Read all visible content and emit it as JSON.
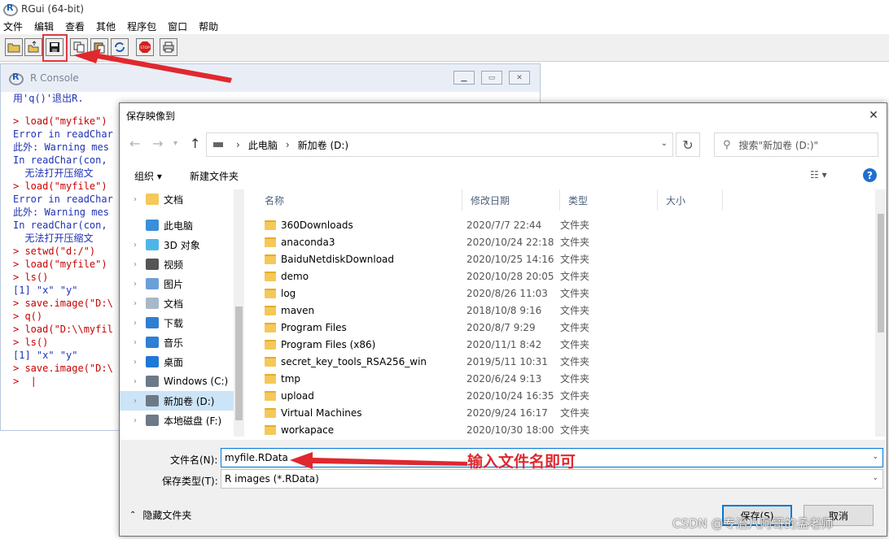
{
  "app": {
    "title": "RGui (64-bit)",
    "menu": [
      "文件",
      "编辑",
      "查看",
      "其他",
      "程序包",
      "窗口",
      "帮助"
    ]
  },
  "toolbar": {
    "buttons": [
      "open-script-icon",
      "load-workspace-icon",
      "save-workspace-icon",
      "copy-icon",
      "paste-icon",
      "copy-paste-icon",
      "stop-icon",
      "print-icon"
    ]
  },
  "console": {
    "title": "R Console",
    "lines": [
      {
        "text": "用'q()'退出R.",
        "color": "blue"
      },
      {
        "text": "",
        "color": "gap"
      },
      {
        "text": "> load(\"myfike\")",
        "color": "red"
      },
      {
        "text": "Error in readChar",
        "color": "blue"
      },
      {
        "text": "此外: Warning mes",
        "color": "blue"
      },
      {
        "text": "In readChar(con,",
        "color": "blue"
      },
      {
        "text": "  无法打开压缩文",
        "color": "blue"
      },
      {
        "text": "> load(\"myfile\")",
        "color": "red"
      },
      {
        "text": "Error in readChar",
        "color": "blue"
      },
      {
        "text": "此外: Warning mes",
        "color": "blue"
      },
      {
        "text": "In readChar(con,",
        "color": "blue"
      },
      {
        "text": "  无法打开压缩文",
        "color": "blue"
      },
      {
        "text": "> setwd(\"d:/\")",
        "color": "red"
      },
      {
        "text": "> load(\"myfile\")",
        "color": "red"
      },
      {
        "text": "> ls()",
        "color": "red"
      },
      {
        "text": "[1] \"x\" \"y\"",
        "color": "blue"
      },
      {
        "text": "> save.image(\"D:\\",
        "color": "red"
      },
      {
        "text": "> q()",
        "color": "red"
      },
      {
        "text": "> load(\"D:\\\\myfil",
        "color": "red"
      },
      {
        "text": "> ls()",
        "color": "red"
      },
      {
        "text": "[1] \"x\" \"y\"",
        "color": "blue"
      },
      {
        "text": "> save.image(\"D:\\",
        "color": "red"
      },
      {
        "text": ">  |",
        "color": "red"
      }
    ]
  },
  "dialog": {
    "title": "保存映像到",
    "breadcrumb": [
      "此电脑",
      "新加卷 (D:)"
    ],
    "search_placeholder": "搜索\"新加卷 (D:)\"",
    "organize": "组织 ▾",
    "new_folder": "新建文件夹",
    "tree": [
      {
        "label": "文档",
        "icon": "folder-icon",
        "chev": true,
        "top": 0
      },
      {
        "label": "此电脑",
        "icon": "computer-icon",
        "chev": false
      },
      {
        "label": "3D 对象",
        "icon": "3d-objects-icon",
        "chev": true
      },
      {
        "label": "视频",
        "icon": "video-icon",
        "chev": true
      },
      {
        "label": "图片",
        "icon": "pictures-icon",
        "chev": true
      },
      {
        "label": "文档",
        "icon": "documents-icon",
        "chev": true
      },
      {
        "label": "下载",
        "icon": "download-icon",
        "chev": true
      },
      {
        "label": "音乐",
        "icon": "music-icon",
        "chev": true
      },
      {
        "label": "桌面",
        "icon": "desktop-icon",
        "chev": true
      },
      {
        "label": "Windows (C:)",
        "icon": "drive-c-icon",
        "chev": true
      },
      {
        "label": "新加卷 (D:)",
        "icon": "drive-d-icon",
        "chev": true,
        "selected": true
      },
      {
        "label": "本地磁盘 (F:)",
        "icon": "drive-f-icon",
        "chev": true
      }
    ],
    "columns": [
      "名称",
      "修改日期",
      "类型",
      "大小"
    ],
    "files": [
      {
        "name": "360Downloads",
        "date": "2020/7/7 22:44",
        "type": "文件夹"
      },
      {
        "name": "anaconda3",
        "date": "2020/10/24 22:18",
        "type": "文件夹"
      },
      {
        "name": "BaiduNetdiskDownload",
        "date": "2020/10/25 14:16",
        "type": "文件夹"
      },
      {
        "name": "demo",
        "date": "2020/10/28 20:05",
        "type": "文件夹"
      },
      {
        "name": "log",
        "date": "2020/8/26 11:03",
        "type": "文件夹"
      },
      {
        "name": "maven",
        "date": "2018/10/8 9:16",
        "type": "文件夹"
      },
      {
        "name": "Program Files",
        "date": "2020/8/7 9:29",
        "type": "文件夹"
      },
      {
        "name": "Program Files (x86)",
        "date": "2020/11/1 8:42",
        "type": "文件夹"
      },
      {
        "name": "secret_key_tools_RSA256_win",
        "date": "2019/5/11 10:31",
        "type": "文件夹"
      },
      {
        "name": "tmp",
        "date": "2020/6/24 9:13",
        "type": "文件夹"
      },
      {
        "name": "upload",
        "date": "2020/10/24 16:35",
        "type": "文件夹"
      },
      {
        "name": "Virtual Machines",
        "date": "2020/9/24 16:17",
        "type": "文件夹"
      },
      {
        "name": "workapace",
        "date": "2020/10/30 18:00",
        "type": "文件夹"
      }
    ],
    "filename_label": "文件名(N):",
    "filename_value": "myfile.RData",
    "filetype_label": "保存类型(T):",
    "filetype_value": "R images (*.RData)",
    "hide_folders": "隐藏文件夹",
    "save_label": "保存(S)",
    "cancel_label": "取消"
  },
  "annotation": {
    "text": "输入文件名即可",
    "color": "#e0282e"
  },
  "watermark": "CSDN @专治八阿哥的孟老师"
}
